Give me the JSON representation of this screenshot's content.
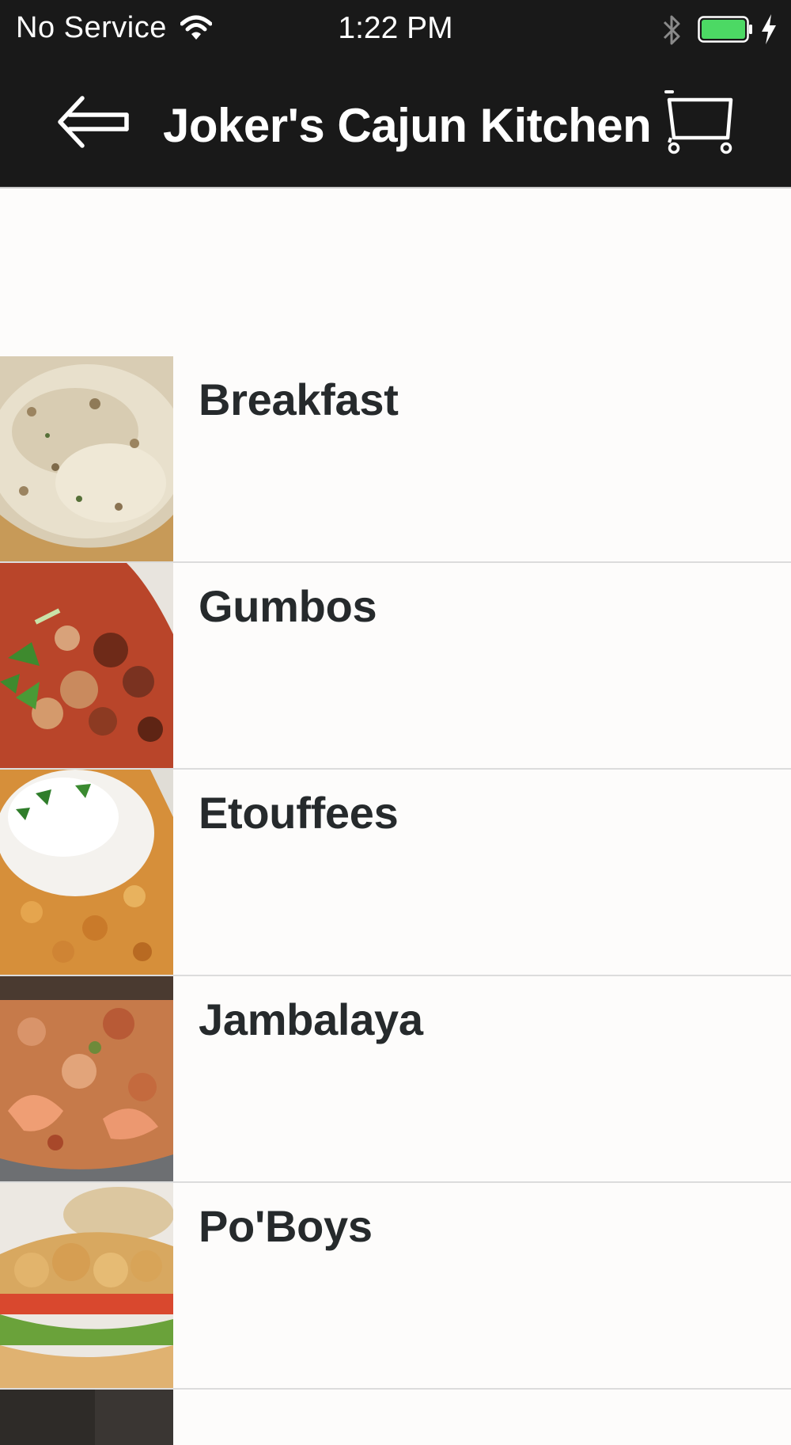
{
  "status_bar": {
    "carrier": "No Service",
    "time": "1:22 PM",
    "battery_color": "#4cd964",
    "icons": [
      "wifi-icon",
      "bluetooth-icon",
      "battery-icon",
      "charging-bolt-icon"
    ]
  },
  "nav": {
    "title": "Joker's Cajun Kitchen",
    "back_icon": "back-arrow-icon",
    "cart_icon": "shopping-cart-icon"
  },
  "categories": [
    {
      "label": "Breakfast",
      "image": "biscuits-and-gravy-photo"
    },
    {
      "label": "Gumbos",
      "image": "gumbo-photo"
    },
    {
      "label": "Etouffees",
      "image": "etouffee-photo"
    },
    {
      "label": "Jambalaya",
      "image": "jambalaya-photo"
    },
    {
      "label": "Po'Boys",
      "image": "poboy-photo"
    }
  ],
  "colors": {
    "bar_background": "#191919",
    "label_text": "#262a2c",
    "background": "#fdfcfb"
  }
}
